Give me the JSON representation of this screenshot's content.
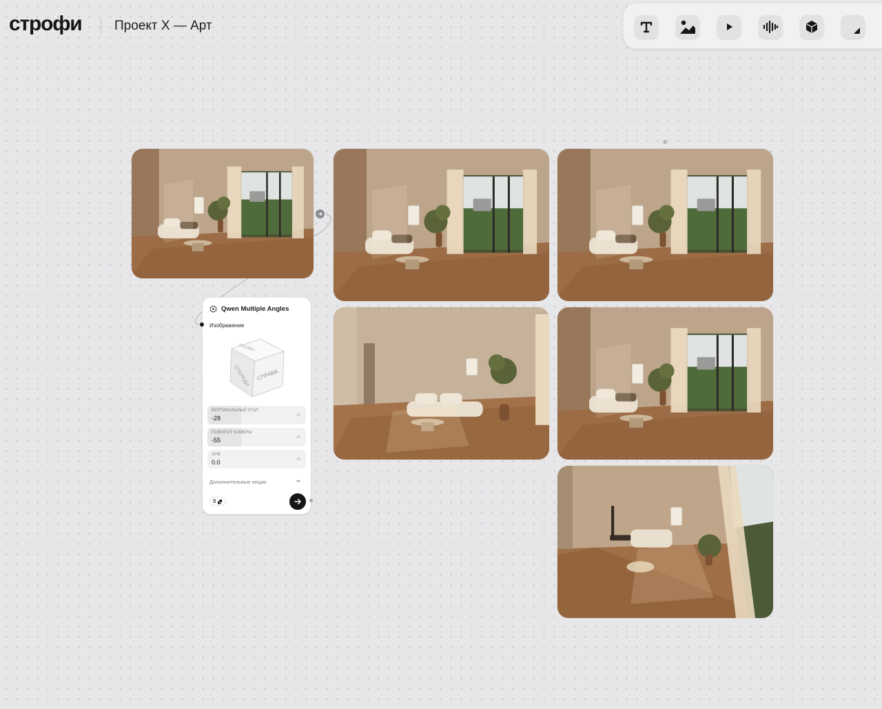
{
  "app": {
    "logo": "строфи",
    "project_title": "Проект X — Арт"
  },
  "toolbar": {
    "tools": [
      {
        "icon": "text-icon"
      },
      {
        "icon": "image-icon"
      },
      {
        "icon": "video-icon"
      },
      {
        "icon": "audio-icon"
      },
      {
        "icon": "3d-object-icon"
      },
      {
        "icon": "sticky-note-icon"
      }
    ]
  },
  "canvas": {
    "source_image": {
      "icon": "room-image"
    },
    "generated_images": [
      {
        "icon": "room-image"
      },
      {
        "icon": "room-image"
      },
      {
        "icon": "room-image"
      },
      {
        "icon": "room-image"
      },
      {
        "icon": "room-image"
      }
    ]
  },
  "node": {
    "title": "Qwen Multiple Angles",
    "input_label": "Изображение",
    "cube_labels": {
      "front": "СПЕРЕДИ",
      "right": "СПРАВА",
      "top": "СВЕРХУ"
    },
    "fields": [
      {
        "label": "ВЕРТИКАЛЬНЫЙ УГОЛ",
        "value": "-28",
        "arrows": "‹›",
        "level": 0.34
      },
      {
        "label": "ПОВОРОТ КАМЕРЫ",
        "value": "-55",
        "arrows": "‹›",
        "level": 0.35
      },
      {
        "label": "ЗУМ",
        "value": "0.0",
        "arrows": "‹›",
        "level": 0
      }
    ],
    "more_options": "Дополнительные опции",
    "count": "8"
  },
  "colors": {
    "accent": "#161616",
    "canvas_bg": "#e7e7e9",
    "panel_bg": "#ffffff"
  }
}
